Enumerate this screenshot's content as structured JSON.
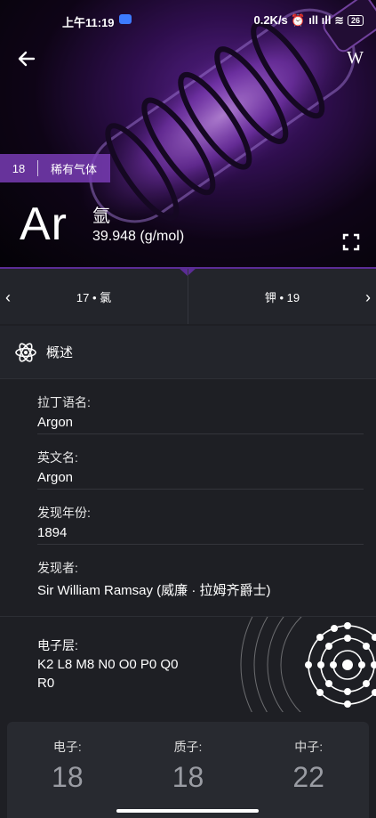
{
  "status_bar": {
    "time": "上午11:19",
    "right": "0.2K/s ⏰ ıll ıll ≋",
    "battery": "26"
  },
  "hero": {
    "group_number": "18",
    "category": "稀有气体",
    "symbol": "Ar",
    "name": "氩",
    "mass": "39.948 (g/mol)",
    "wiki_label": "W"
  },
  "nav": {
    "prev": "17 • 氯",
    "next": "钾 • 19"
  },
  "section": {
    "title": "概述"
  },
  "info": [
    {
      "label": "拉丁语名:",
      "value": "Argon"
    },
    {
      "label": "英文名:",
      "value": "Argon"
    },
    {
      "label": "发现年份:",
      "value": "1894"
    },
    {
      "label": "发现者:",
      "value": "Sir William Ramsay (威廉 · 拉姆齐爵士)"
    }
  ],
  "shell": {
    "label": "电子层:",
    "line1": "K2 L8 M8 N0 O0 P0 Q0",
    "line2": "R0"
  },
  "counts": [
    {
      "label": "电子:",
      "value": "18"
    },
    {
      "label": "质子:",
      "value": "18"
    },
    {
      "label": "中子:",
      "value": "22"
    }
  ],
  "colors": {
    "accent": "#5b2c95",
    "background": "#1e1f24",
    "panel": "#23252b"
  }
}
